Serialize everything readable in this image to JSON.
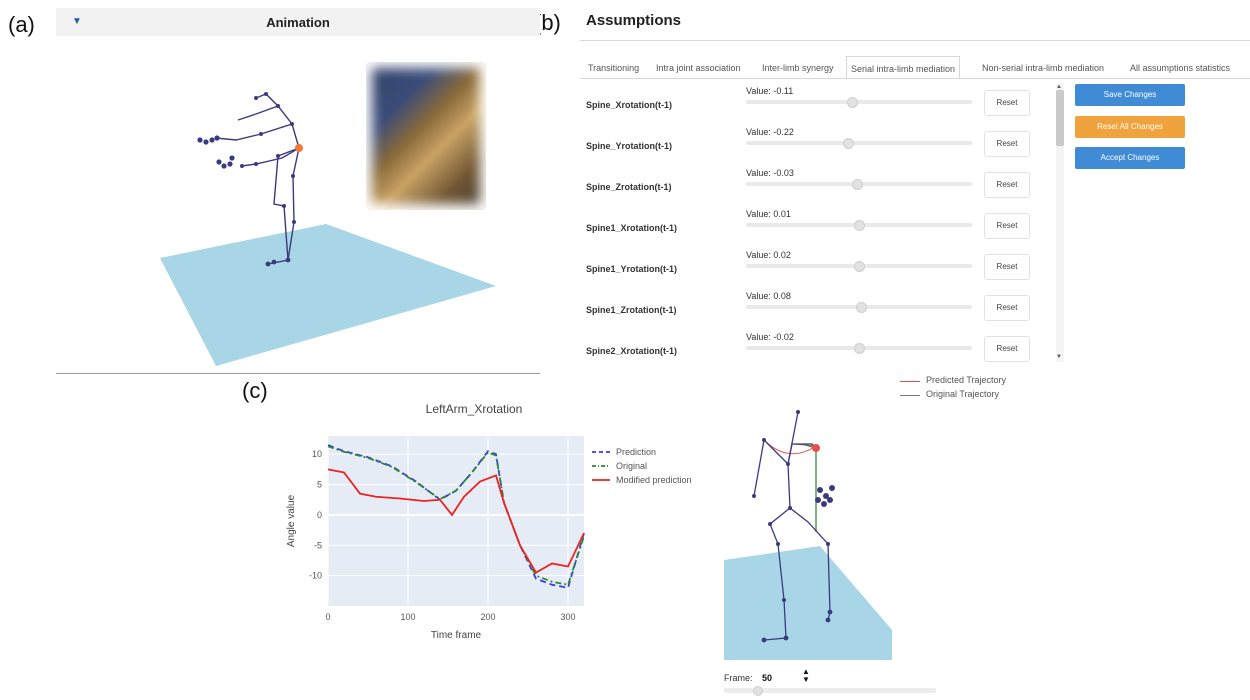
{
  "labels": {
    "a": "(a)",
    "b": "(b)",
    "c": "(c)"
  },
  "animation": {
    "title": "Animation",
    "toggle_icon": "triangle-down"
  },
  "assumptions": {
    "title": "Assumptions",
    "tabs": [
      {
        "label": "Transitioning",
        "active": false
      },
      {
        "label": "Intra joint association",
        "active": false
      },
      {
        "label": "Inter-limb synergy",
        "active": false
      },
      {
        "label": "Serial intra-limb mediation",
        "active": true
      },
      {
        "label": "Non-serial intra-limb mediation",
        "active": false
      },
      {
        "label": "All assumptions statistics",
        "active": false
      }
    ],
    "params": [
      {
        "name": "Spine_Xrotation(t-1)",
        "value": "Value: -0.11",
        "level": 0.47
      },
      {
        "name": "Spine_Yrotation(t-1)",
        "value": "Value: -0.22",
        "level": 0.45
      },
      {
        "name": "Spine_Zrotation(t-1)",
        "value": "Value: -0.03",
        "level": 0.49
      },
      {
        "name": "Spine1_Xrotation(t-1)",
        "value": "Value: 0.01",
        "level": 0.5
      },
      {
        "name": "Spine1_Yrotation(t-1)",
        "value": "Value: 0.02",
        "level": 0.5
      },
      {
        "name": "Spine1_Zrotation(t-1)",
        "value": "Value: 0.08",
        "level": 0.51
      },
      {
        "name": "Spine2_Xrotation(t-1)",
        "value": "Value: -0.02",
        "level": 0.5
      }
    ],
    "reset_label": "Reset",
    "buttons": {
      "save": "Save Changes",
      "reset_all": "Reset All Changes",
      "accept": "Accept Changes"
    },
    "colors": {
      "blue": "#3f8bd6",
      "orange": "#f0a23c"
    }
  },
  "trajectory_legend": {
    "predicted": "Predicted Trajectory",
    "original": "Original Trajectory",
    "predicted_color": "#e85050",
    "original_color": "#777777"
  },
  "frame": {
    "label": "Frame:",
    "value": "50",
    "level": 0.16
  },
  "chart_data": {
    "type": "line",
    "title": "LeftArm_Xrotation",
    "xlabel": "Time frame",
    "ylabel": "Angle value",
    "xlim": [
      0,
      320
    ],
    "ylim": [
      -15,
      13
    ],
    "xticks": [
      0,
      100,
      200,
      300
    ],
    "yticks": [
      -10,
      -5,
      0,
      5,
      10
    ],
    "grid": true,
    "legend_placement": "top-right",
    "series": [
      {
        "name": "Prediction",
        "style": "dashed",
        "color": "#3a3af0",
        "x": [
          0,
          20,
          50,
          80,
          110,
          140,
          160,
          180,
          200,
          210,
          220,
          240,
          260,
          280,
          300,
          320
        ],
        "y": [
          11.5,
          10.5,
          9.5,
          8,
          5.5,
          2.5,
          4,
          7,
          10.5,
          10,
          2,
          -5,
          -10.5,
          -11.5,
          -12,
          -3
        ]
      },
      {
        "name": "Original",
        "style": "dashdot",
        "color": "#2a8a2a",
        "x": [
          0,
          20,
          50,
          80,
          110,
          140,
          160,
          180,
          200,
          210,
          220,
          240,
          260,
          280,
          300,
          320
        ],
        "y": [
          11.3,
          10.4,
          9.4,
          7.9,
          5.4,
          2.6,
          4,
          7,
          10.3,
          9.8,
          2,
          -5,
          -10,
          -11,
          -11.5,
          -3.5
        ]
      },
      {
        "name": "Modified prediction",
        "style": "solid",
        "color": "#ee2222",
        "x": [
          0,
          20,
          40,
          60,
          90,
          120,
          140,
          155,
          170,
          190,
          210,
          220,
          240,
          260,
          280,
          300,
          320
        ],
        "y": [
          7.5,
          7,
          3.5,
          3,
          2.7,
          2.3,
          2.5,
          0,
          3,
          5.5,
          6.5,
          2,
          -5,
          -9.5,
          -8,
          -8.5,
          -3
        ]
      }
    ]
  }
}
